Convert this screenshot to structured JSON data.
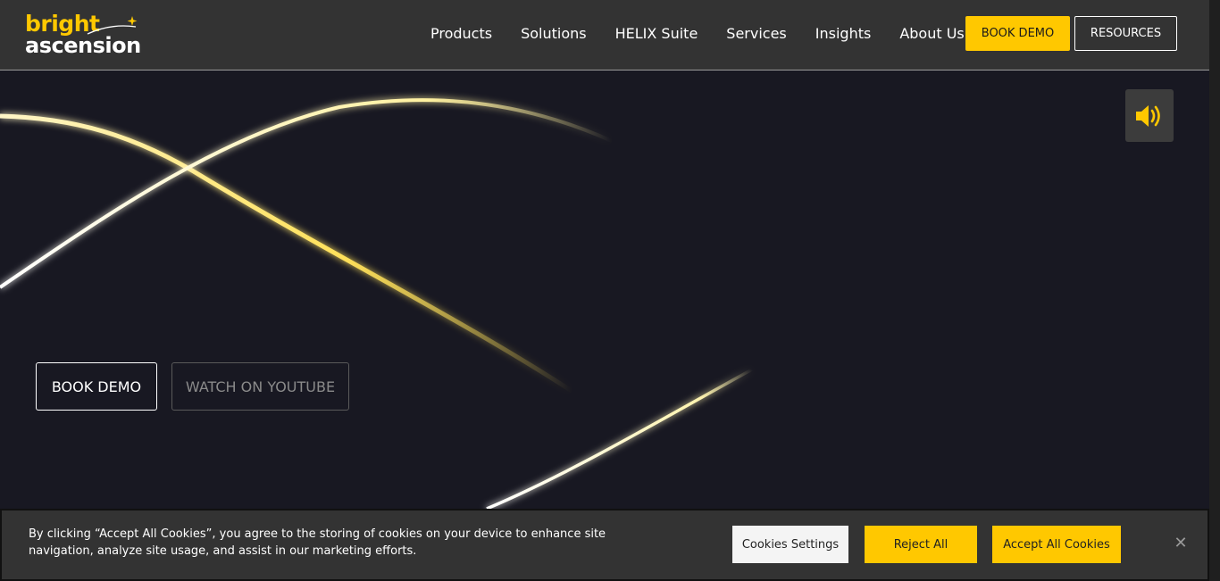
{
  "brand": {
    "logo_line1": "bright",
    "logo_line2": "ascension",
    "accent_color": "#ffc800",
    "logo_icon": "star-swoosh-icon"
  },
  "nav": {
    "items": [
      {
        "label": "Products"
      },
      {
        "label": "Solutions"
      },
      {
        "label": "HELIX Suite"
      },
      {
        "label": "Services"
      },
      {
        "label": "Insights"
      },
      {
        "label": "About Us"
      }
    ],
    "book_demo_label": "BOOK DEMO",
    "resources_label": "RESOURCES"
  },
  "hero": {
    "sound_icon": "speaker-volume-icon",
    "book_demo_label": "BOOK DEMO",
    "youtube_label": "WATCH ON YOUTUBE",
    "background_color": "#181822"
  },
  "cookie_banner": {
    "text": "By clicking “Accept All Cookies”, you agree to the storing of cookies on your device to enhance site navigation, analyze site usage, and assist in our marketing efforts.",
    "settings_label": "Cookies Settings",
    "reject_label": "Reject All",
    "accept_label": "Accept All Cookies",
    "close_label": "✕"
  }
}
